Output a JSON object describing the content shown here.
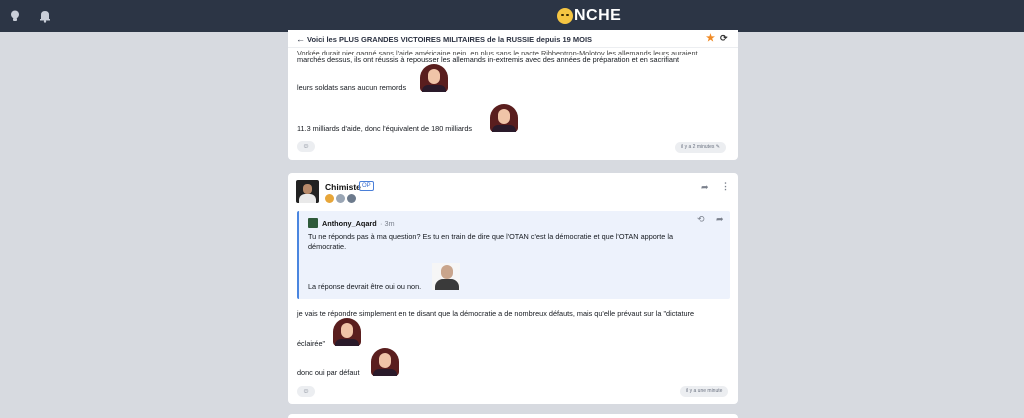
{
  "topbar": {
    "logo_text": "NCHE",
    "icons": [
      "bulb-icon",
      "bell-icon"
    ]
  },
  "topic": {
    "title": "Voici les PLUS GRANDES VICTOIRES MILITAIRES de la RUSSIE depuis 19 MOIS"
  },
  "post1": {
    "line_cut": "Vorkée durait nier gagné sans l'aide américaine nein, en plus sans le pacte Ribbentrop-Molotov les allemands leurs auraient",
    "line2": "marchés dessus, ils ont réussis à repousser les allemands in-extremis avec des années de préparation et en sacrifiant",
    "line3": "leurs soldats sans aucun remords",
    "line4": "11.3 milliards d'aide, donc l'équivalent de 180 milliards",
    "time": "il y a 2 minutes"
  },
  "post2": {
    "author": "Chimiste",
    "op_label": "OP",
    "quote": {
      "author": "Anthony_Aqard",
      "time": "· 3m",
      "line1": "Tu ne réponds pas à ma question? Es tu en train de dire que l'OTAN c'est la démocratie et que l'OTAN apporte la",
      "line2": "démocratie.",
      "line3": "La réponse devrait être oui ou non."
    },
    "line1": "je vais te répondre simplement en te disant que la démocratie a de nombreux défauts, mais qu'elle prévaut sur la \"dictature",
    "line2": "éclairée\"",
    "line3": "donc oui par défaut",
    "time": "il y a une minute"
  }
}
